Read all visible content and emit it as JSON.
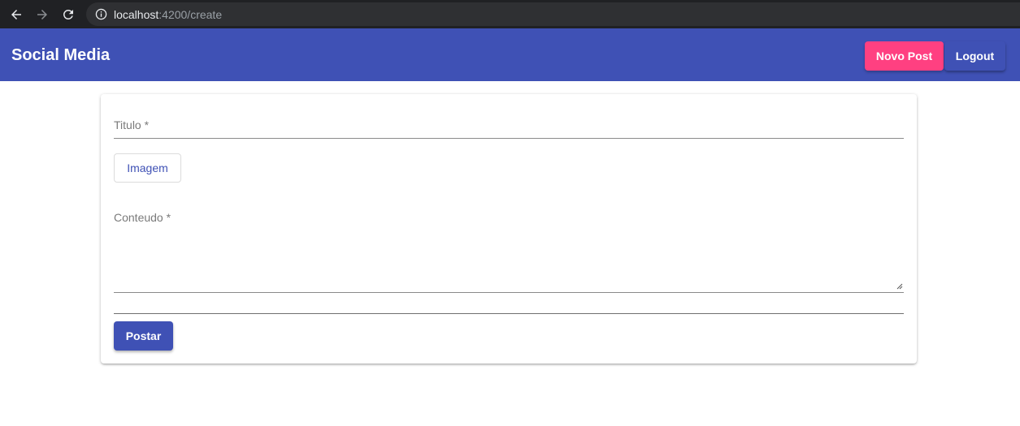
{
  "browser": {
    "url_host": "localhost",
    "url_path": ":4200/create",
    "icons": [
      "back-arrow-icon",
      "forward-arrow-icon",
      "reload-icon",
      "info-icon"
    ]
  },
  "toolbar": {
    "title": "Social Media",
    "new_post_label": "Novo Post",
    "logout_label": "Logout"
  },
  "form": {
    "title_label": "Titulo *",
    "image_button_label": "Imagem",
    "content_label": "Conteudo *",
    "submit_label": "Postar"
  },
  "colors": {
    "primary": "#3f51b5",
    "accent": "#ff4081",
    "browser_dark": "#202124"
  }
}
